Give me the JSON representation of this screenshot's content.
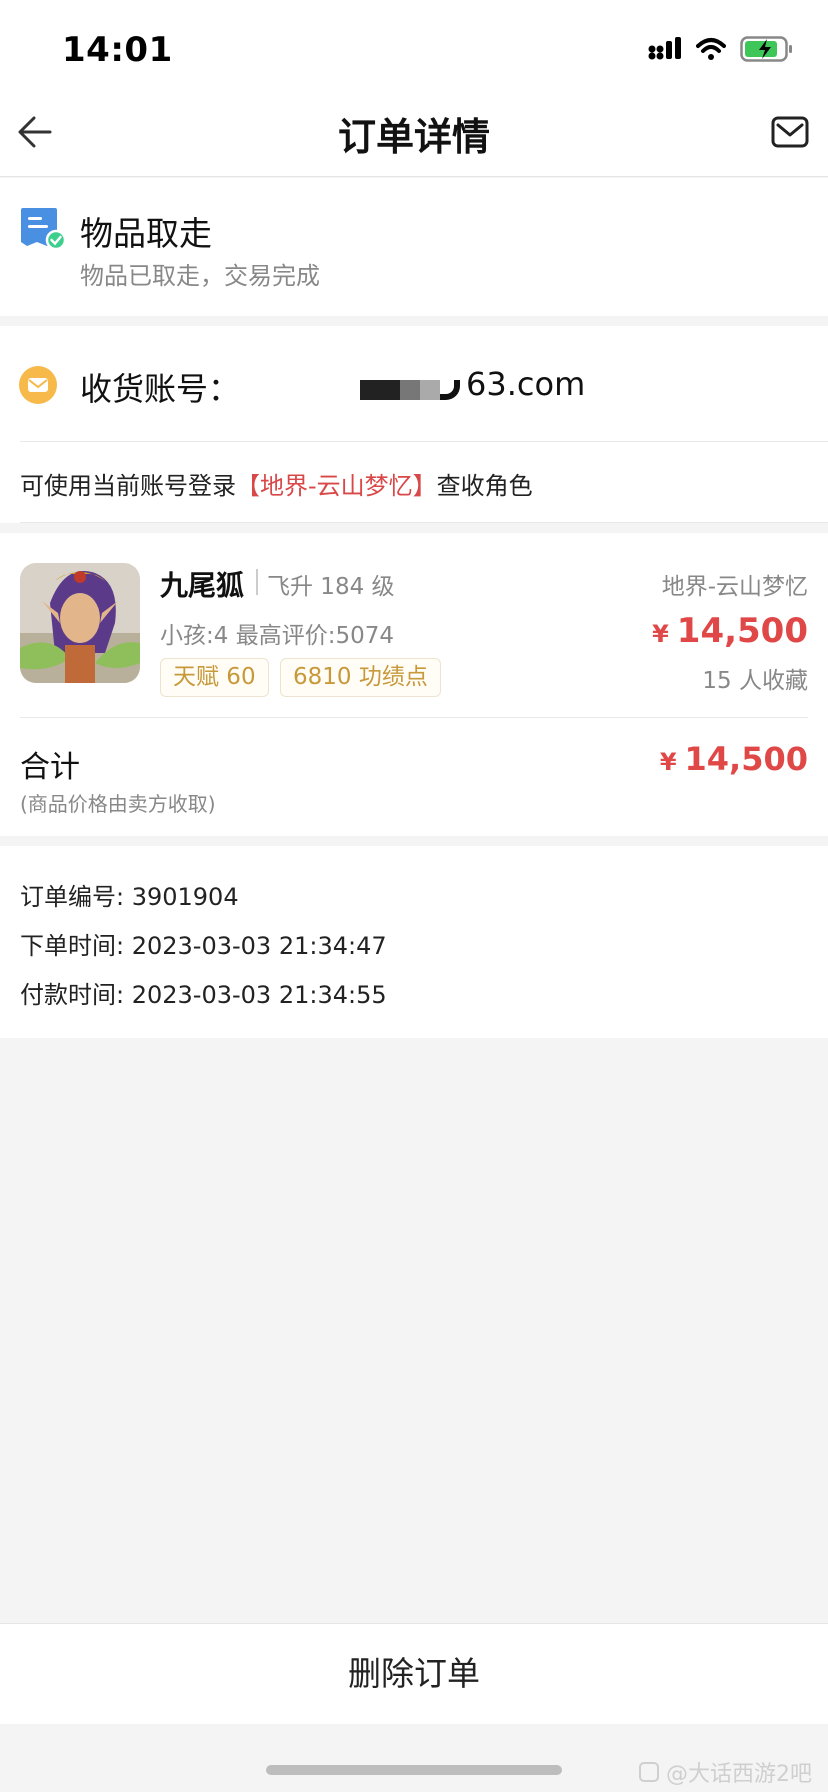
{
  "status_bar": {
    "time": "14:01"
  },
  "nav": {
    "title": "订单详情"
  },
  "order_status": {
    "title": "物品取走",
    "subtitle": "物品已取走，交易完成"
  },
  "account": {
    "label": "收货账号：",
    "value_visible": "63.com",
    "note_prefix": "可使用当前账号登录",
    "note_server": "【地界-云山梦忆】",
    "note_suffix": "查收角色"
  },
  "item": {
    "name": "九尾狐",
    "level": "飞升 184 级",
    "meta": "小孩:4 最高评价:5074",
    "tags": [
      "天赋 60",
      "6810 功绩点"
    ],
    "server": "地界-云山梦忆",
    "currency": "¥",
    "price": "14,500",
    "favorites": "15 人收藏"
  },
  "total": {
    "label": "合计",
    "note": "(商品价格由卖方收取)",
    "currency": "¥",
    "price": "14,500"
  },
  "order_info": {
    "order_no": "订单编号: 3901904",
    "order_time": "下单时间: 2023-03-03 21:34:47",
    "pay_time": "付款时间: 2023-03-03 21:34:55"
  },
  "actions": {
    "delete": "删除订单"
  },
  "watermark": "@大话西游2吧",
  "colors": {
    "price": "#e04848",
    "highlight": "#d94848",
    "tag": "#c7993a",
    "status_icon": "#4a90e2",
    "check": "#3ccf8e",
    "account_icon": "#f6b94a"
  }
}
